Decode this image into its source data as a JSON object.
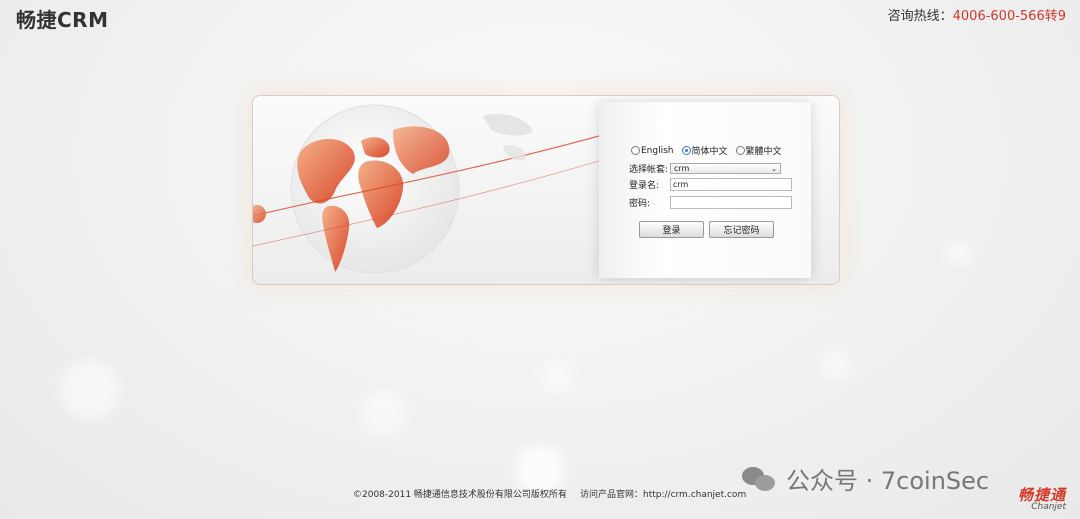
{
  "header": {
    "logo_text": "畅捷CRM",
    "hotline_label": "咨询热线：",
    "hotline_number": "4006-600-566转9"
  },
  "login": {
    "languages": [
      {
        "label": "English",
        "selected": false
      },
      {
        "label": "简体中文",
        "selected": true
      },
      {
        "label": "繁體中文",
        "selected": false
      }
    ],
    "account_set_label": "选择帐套:",
    "account_set_value": "crm",
    "username_label": "登录名:",
    "username_value": "crm",
    "password_label": "密码:",
    "password_value": "",
    "login_button": "登录",
    "forgot_button": "忘记密码"
  },
  "footer": {
    "copyright": "©2008-2011 畅捷通信息技术股份有限公司版权所有",
    "visit_text": "访问产品官网：http://crm.chanjet.com"
  },
  "watermark": {
    "text": "公众号 · 7coinSec"
  },
  "brand": {
    "cn": "畅捷通",
    "en": "Chanjet"
  },
  "colors": {
    "accent_red": "#d9352c",
    "radio_blue": "#3a79d6"
  }
}
